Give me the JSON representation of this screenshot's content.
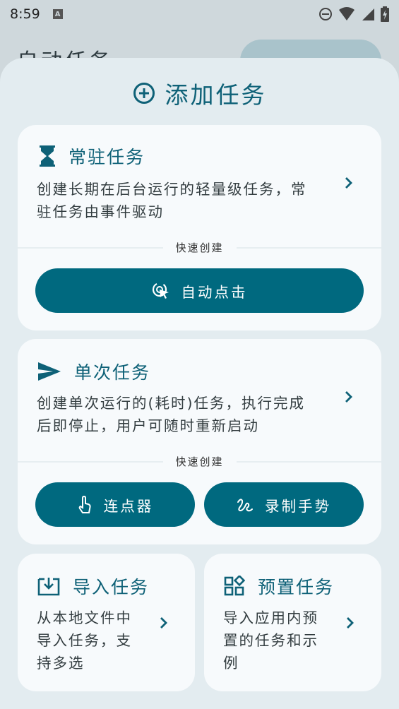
{
  "status_bar": {
    "time": "8:59",
    "a_badge": "A"
  },
  "background": {
    "title": "自动任务"
  },
  "sheet": {
    "title": "添加任务",
    "resident": {
      "title": "常驻任务",
      "desc_line1": "创建长期在后台运行的轻量级任务，常",
      "desc_line2": "驻任务由事件驱动",
      "quick_label": "快速创建",
      "auto_click_label": "自动点击"
    },
    "single": {
      "title": "单次任务",
      "desc_line1": "创建单次运行的(耗时)任务，执行完成",
      "desc_line2": "后即停止，用户可随时重新启动",
      "quick_label": "快速创建",
      "clicker_label": "连点器",
      "gesture_label": "录制手势"
    },
    "import": {
      "title": "导入任务",
      "desc_line1": "从本地文件中",
      "desc_line2": "导入任务，支",
      "desc_line3": "持多选"
    },
    "preset": {
      "title": "预置任务",
      "desc_line1": "导入应用内预",
      "desc_line2": "置的任务和示",
      "desc_line3": "例"
    }
  },
  "colors": {
    "accent": "#00697f",
    "sheet_bg": "#e3ecf0",
    "card_bg": "#f7fafc"
  }
}
